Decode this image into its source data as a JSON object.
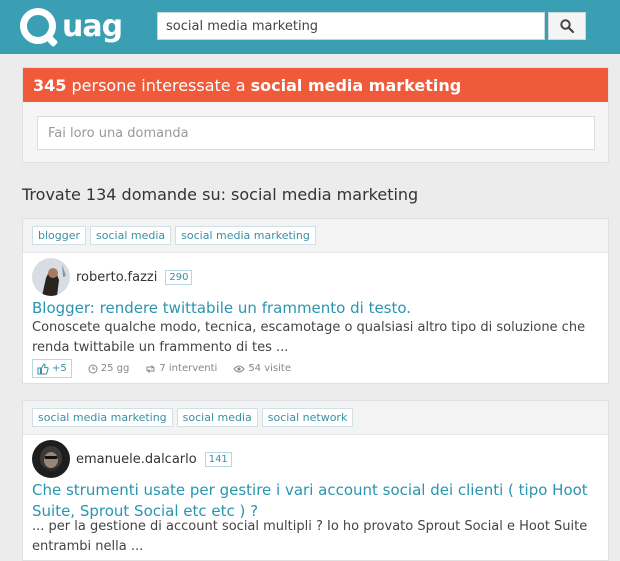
{
  "header": {
    "logo_text": "uag",
    "search_value": "social media marketing"
  },
  "banner": {
    "count": "345",
    "text": " persone interessate a ",
    "topic": "social media marketing",
    "ask_placeholder": "Fai loro una domanda"
  },
  "results_title": "Trovate 134 domande su: social media marketing",
  "questions": [
    {
      "tags": [
        "blogger",
        "social media",
        "social media marketing"
      ],
      "author": "roberto.fazzi",
      "reputation": "290",
      "title": "Blogger: rendere twittabile un frammento di testo.",
      "excerpt": "Conoscete qualche modo, tecnica, escamotage o qualsiasi altro tipo di soluzione che renda twittabile un frammento di tes ...",
      "votes": "+5",
      "age": "25 gg",
      "answers": "7 interventi",
      "views": "54 visite"
    },
    {
      "tags": [
        "social media marketing",
        "social media",
        "social network"
      ],
      "author": "emanuele.dalcarlo",
      "reputation": "141",
      "title": "Che strumenti usate per gestire i vari account social dei clienti ( tipo Hoot Suite, Sprout Social etc etc ) ?",
      "excerpt": "... per la gestione di account social multipli ? Io ho provato Sprout Social e Hoot Suite entrambi nella ..."
    }
  ],
  "colors": {
    "header_bg": "#3b9fb4",
    "banner_bg": "#ef5a3a",
    "link": "#2a95b0"
  }
}
